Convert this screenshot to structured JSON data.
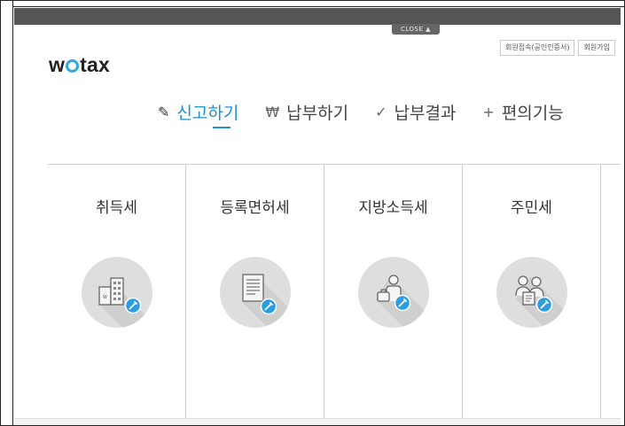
{
  "close_tab": "CLOSE ▲",
  "logo": {
    "w": "w",
    "tax": "tax"
  },
  "top_links": [
    "회원접속(공인인증서)",
    "회원가입"
  ],
  "nav": [
    {
      "icon": "pencil-icon",
      "glyph": "✎",
      "label": "신고하기",
      "active": true
    },
    {
      "icon": "won-icon",
      "glyph": "₩",
      "label": "납부하기",
      "active": false
    },
    {
      "icon": "check-icon",
      "glyph": "✓",
      "label": "납부결과",
      "active": false
    },
    {
      "icon": "plus-icon",
      "glyph": "+",
      "label": "편의기능",
      "active": false
    }
  ],
  "tax_cards": [
    {
      "title": "취득세",
      "icon": "buildings-icon"
    },
    {
      "title": "등록면허세",
      "icon": "document-icon"
    },
    {
      "title": "지방소득세",
      "icon": "worker-icon"
    },
    {
      "title": "주민세",
      "icon": "people-icon"
    }
  ],
  "colors": {
    "accent": "#1f8fd0",
    "badge": "#2a9ee0",
    "circle": "#dedede",
    "topbar": "#555555"
  }
}
